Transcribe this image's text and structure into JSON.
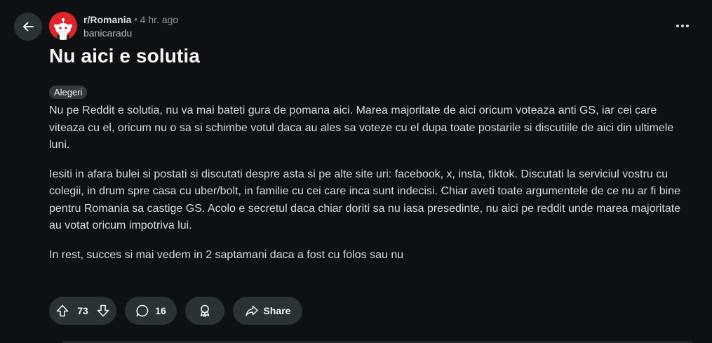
{
  "post": {
    "subreddit": "r/Romania",
    "separator": "•",
    "time": "4 hr. ago",
    "author": "banicaradu",
    "title": "Nu aici e solutia",
    "flair": "Alegeri",
    "body": [
      "Nu pe Reddit e solutia, nu va mai bateti gura de pomana aici. Marea majoritate de aici oricum voteaza anti GS, iar cei care viteaza cu el, oricum nu o sa si schimbe votul daca au ales sa voteze cu el dupa toate postarile si discutiile de aici din ultimele luni.",
      "Iesiti in afara bulei si postati si discutati despre asta si pe alte site uri: facebook, x, insta, tiktok. Discutati la serviciul vostru cu colegii, in drum spre casa cu uber/bolt, in familie cu cei care inca sunt indecisi. Chiar aveti toate argumentele de ce nu ar fi bine pentru Romania sa castige GS. Acolo e secretul daca chiar doriti sa nu iasa presedinte, nu aici pe reddit unde marea majoritate au votat oricum impotriva lui.",
      "In rest, succes si mai vedem in 2 saptamani daca a fost cu folos sau nu"
    ]
  },
  "actions": {
    "upvotes": "73",
    "comments": "16",
    "share_label": "Share"
  },
  "icons": {
    "back": "arrow-left-icon",
    "more": "more-horizontal-icon",
    "upvote": "upvote-arrow-icon",
    "downvote": "downvote-arrow-icon",
    "comment": "comment-bubble-icon",
    "award": "award-icon",
    "share": "share-arrow-icon"
  },
  "colors": {
    "background": "#0e1113",
    "button": "#2a3236",
    "avatar": "#e0242b"
  }
}
